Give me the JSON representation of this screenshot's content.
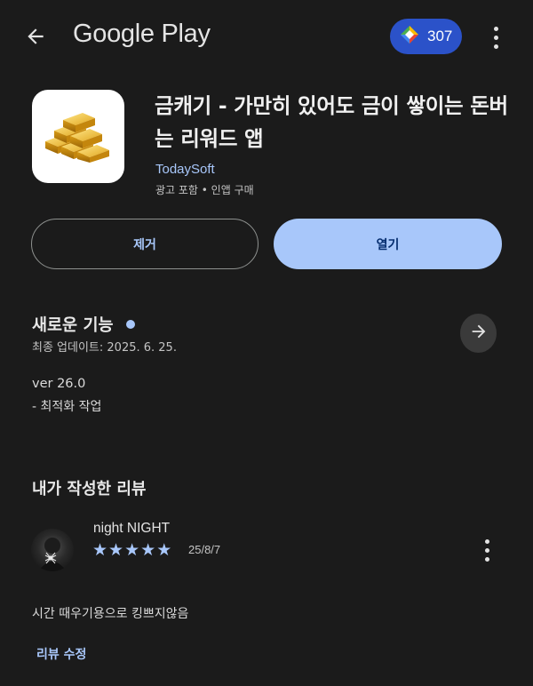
{
  "header": {
    "brand": "Google Play",
    "points": "307",
    "colors": {
      "points_bg": "#2b52c9",
      "accent": "#a8c7fa"
    },
    "icons": [
      "back-arrow-icon",
      "play-points-icon",
      "more-vert-icon"
    ]
  },
  "app": {
    "title": "금캐기 - 가만히 있어도 금이 쌓이는 돈버는 리워드 앱",
    "developer": "TodaySoft",
    "meta": "광고 포함 • 인앱 구매",
    "icon": "gold-bars-icon"
  },
  "actions": {
    "remove_label": "제거",
    "open_label": "열기"
  },
  "whats_new": {
    "title": "새로운 기능",
    "updated": "최종 업데이트: 2025. 6. 25.",
    "version": "ver 26.0",
    "note": "- 최적화 작업",
    "icon": "arrow-forward-icon"
  },
  "my_review": {
    "heading": "내가 작성한 리뷰",
    "author": "night NIGHT",
    "rating": 5,
    "date": "25/8/7",
    "text": "시간 때우기용으로 킹쁘지않음",
    "edit_label": "리뷰 수정"
  }
}
